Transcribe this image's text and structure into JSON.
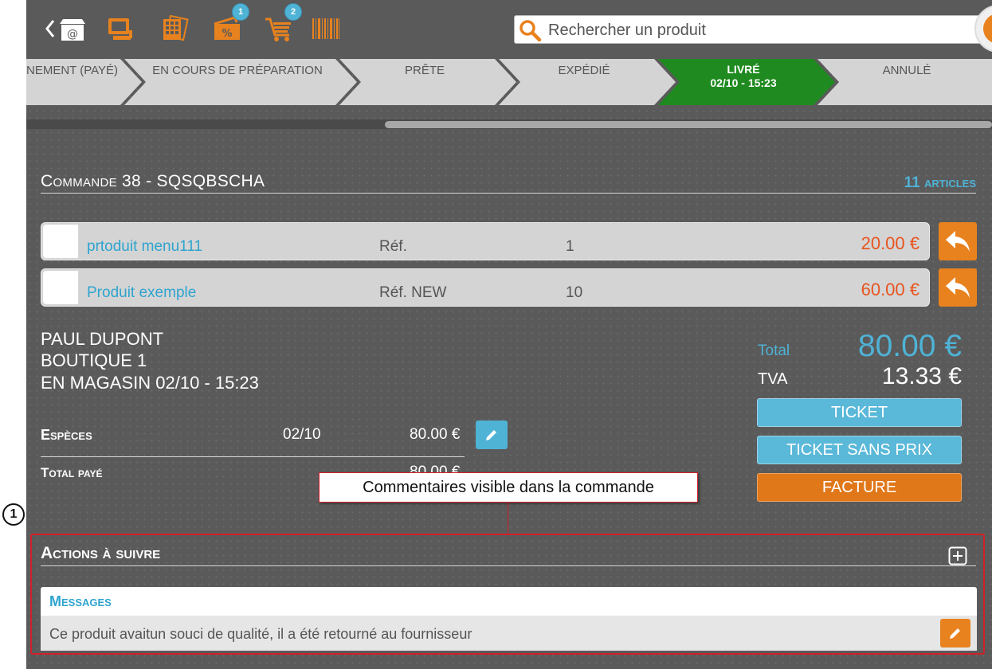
{
  "toolbar": {
    "badges": {
      "promo": "1",
      "cart": "2"
    }
  },
  "search": {
    "placeholder": "Rechercher un produit"
  },
  "steps": [
    {
      "label": "NEMENT (PAYÉ)",
      "sub": ""
    },
    {
      "label": "EN COURS DE PRÉPARATION",
      "sub": ""
    },
    {
      "label": "PRÊTE",
      "sub": ""
    },
    {
      "label": "EXPÉDIÉ",
      "sub": ""
    },
    {
      "label": "LIVRÉ",
      "sub": "02/10 - 15:23"
    },
    {
      "label": "ANNULÉ",
      "sub": ""
    }
  ],
  "order": {
    "title": "Commande 38 - SQSQBSCHA",
    "count": "11 articles"
  },
  "items": [
    {
      "name": "prtoduit menu111",
      "ref": "Réf.",
      "qty": "1",
      "price": "20.00 €"
    },
    {
      "name": "Produit exemple",
      "ref": "Réf. NEW",
      "qty": "10",
      "price": "60.00 €"
    }
  ],
  "customer": {
    "name": "PAUL DUPONT",
    "store": "BOUTIQUE 1",
    "pickup": "EN MAGASIN 02/10 - 15:23"
  },
  "payment": {
    "method": "Espèces",
    "date": "02/10",
    "amount": "80.00 €",
    "total_label": "Total payé",
    "total_amount": "80.00 €"
  },
  "totals": {
    "total_label": "Total",
    "total_value": "80.00 €",
    "tva_label": "TVA",
    "tva_value": "13.33 €"
  },
  "buttons": {
    "ticket": "TICKET",
    "ticket_no_price": "TICKET SANS PRIX",
    "invoice": "FACTURE"
  },
  "actions": {
    "title": "Actions à suivre",
    "messages_title": "Messages",
    "message": "Ce produit avaitun souci de qualité, il a été retourné au fournisseur"
  },
  "annotation": {
    "callout": "Commentaires visible dans la commande",
    "marker": "1"
  },
  "colors": {
    "background": "#5a5a5a",
    "accent_blue": "#4fb3d6",
    "accent_orange": "#e8821e",
    "price_red": "#e8541e",
    "active_step": "#1f8a1f",
    "annotation_red": "#d0202a"
  }
}
